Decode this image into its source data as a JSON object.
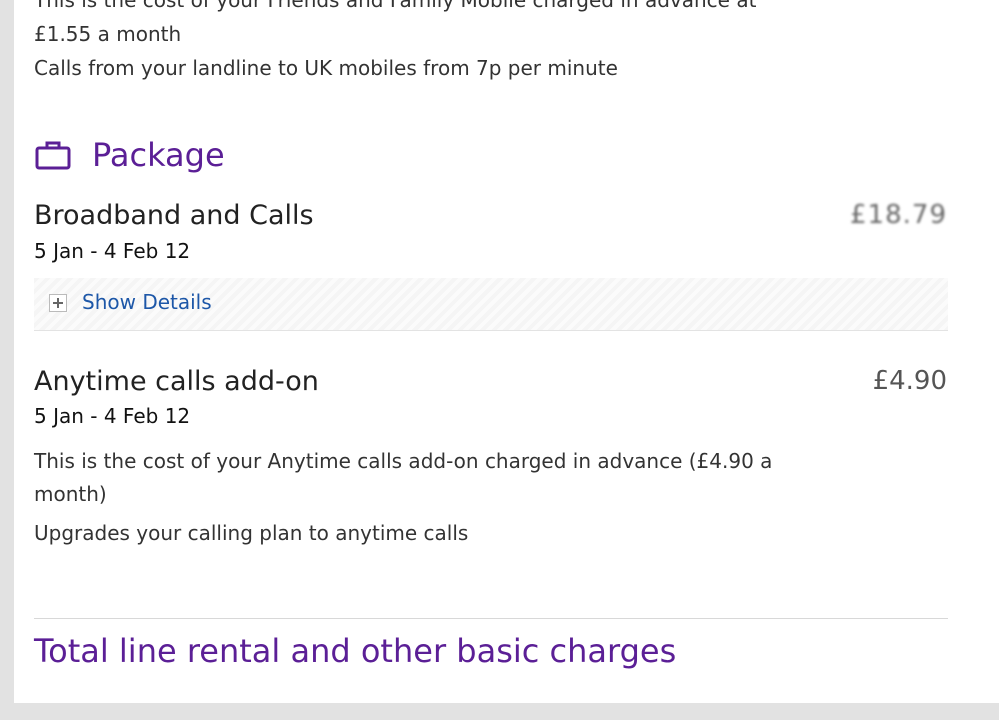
{
  "top_text": {
    "cut_line": "This is the cost of your Friends and Family Mobile charged in advance at",
    "line1": "£1.55 a month",
    "line2": "Calls from your landline to UK mobiles from 7p per minute"
  },
  "package": {
    "icon": "briefcase-icon",
    "heading": "Package"
  },
  "items": [
    {
      "title": "Broadband and Calls",
      "date": "5 Jan - 4 Feb 12",
      "price": "£18.79",
      "details_label": "Show Details"
    },
    {
      "title": "Anytime calls add-on",
      "date": "5 Jan - 4 Feb 12",
      "price": "£4.90",
      "description": "This is the cost of your Anytime calls add-on charged in advance (£4.90 a month)",
      "note": "Upgrades your calling plan to anytime calls"
    }
  ],
  "total": {
    "heading": "Total line rental and other basic charges"
  },
  "colors": {
    "accent": "#5b1f96",
    "link": "#1d57a8"
  }
}
